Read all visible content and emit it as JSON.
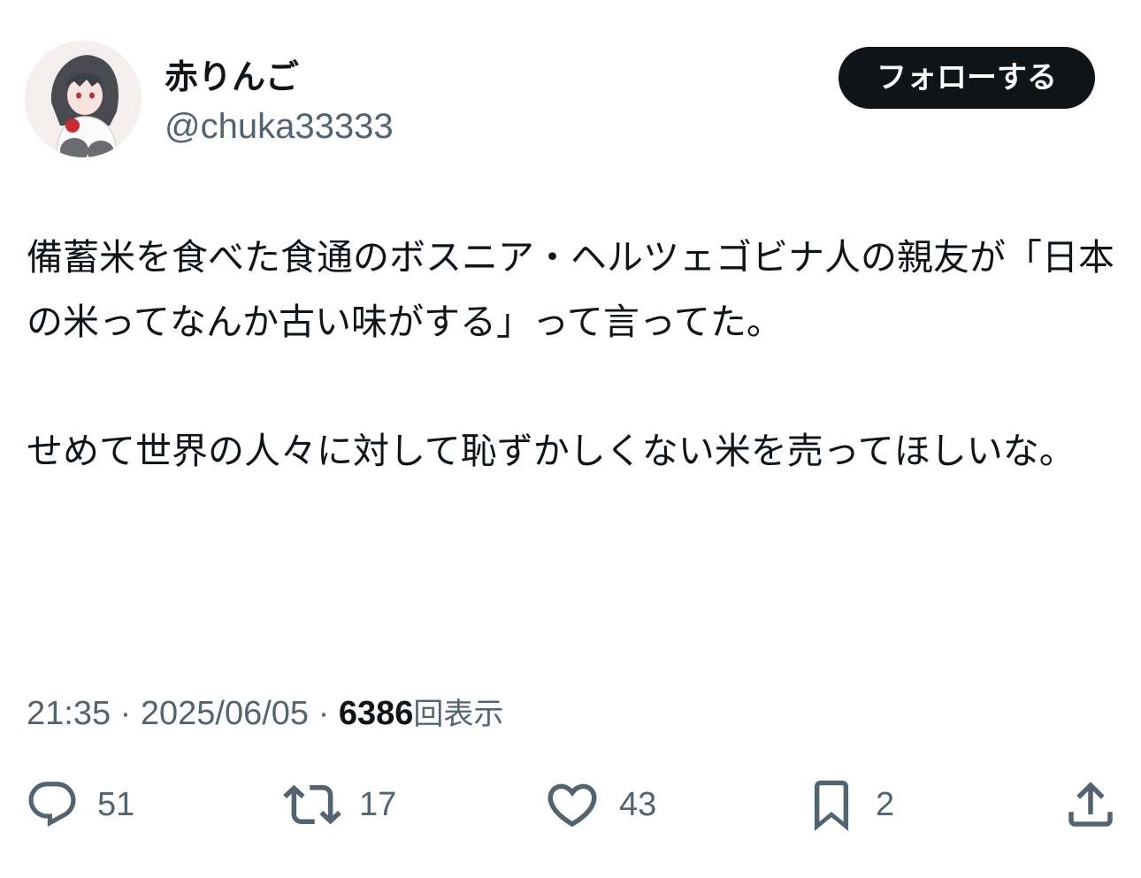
{
  "user": {
    "display_name": "赤りんご",
    "handle": "@chuka33333",
    "avatar_icon": "avatar-illustration"
  },
  "follow_button": {
    "label": "フォローする"
  },
  "tweet": {
    "paragraphs": [
      "備蓄米を食べた食通のボスニア・ヘルツェゴビナ人の親友が「日本の米ってなんか古い味がする」って言ってた。",
      "せめて世界の人々に対して恥ずかしくない米を売ってほしいな。"
    ]
  },
  "meta": {
    "time": "21:35",
    "separator": " · ",
    "date": "2025/06/05",
    "views_count": "6386",
    "views_label": "回表示"
  },
  "actions": {
    "reply": {
      "icon": "reply-icon",
      "count": "51"
    },
    "retweet": {
      "icon": "retweet-icon",
      "count": "17"
    },
    "like": {
      "icon": "heart-icon",
      "count": "43"
    },
    "bookmark": {
      "icon": "bookmark-icon",
      "count": "2"
    },
    "share": {
      "icon": "share-icon"
    }
  },
  "colors": {
    "text_primary": "#0f1419",
    "text_secondary": "#536471",
    "button_bg": "#0f1419",
    "button_text": "#ffffff"
  }
}
